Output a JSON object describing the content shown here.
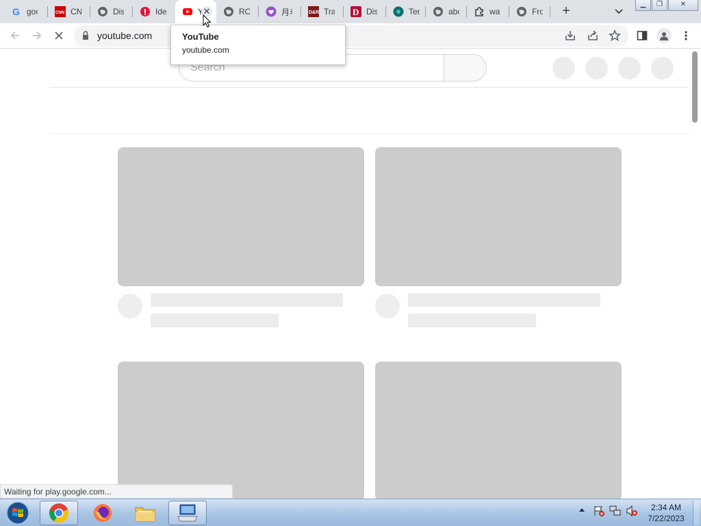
{
  "browser": {
    "tabs": [
      {
        "title": "goo",
        "icon": "google-icon"
      },
      {
        "title": "CNI",
        "icon": "cnn-icon"
      },
      {
        "title": "Dish",
        "icon": "globe-icon"
      },
      {
        "title": "Ider",
        "icon": "red-alert-icon"
      },
      {
        "title": "Y",
        "icon": "youtube-icon",
        "active": true
      },
      {
        "title": "RC (",
        "icon": "globe-icon"
      },
      {
        "title": "月老",
        "icon": "heart-icon"
      },
      {
        "title": "Trav",
        "icon": "dr-icon"
      },
      {
        "title": "Disr",
        "icon": "disney-icon"
      },
      {
        "title": "Tem",
        "icon": "teal-circle-icon"
      },
      {
        "title": "abc",
        "icon": "globe-icon"
      },
      {
        "title": "wat",
        "icon": "puzzle-icon"
      },
      {
        "title": "Fron",
        "icon": "globe-icon"
      }
    ],
    "new_tab_label": "+",
    "url": "youtube.com",
    "tooltip": {
      "title": "YouTube",
      "url": "youtube.com"
    },
    "status_text": "Waiting for play.google.com..."
  },
  "page": {
    "search_placeholder": "Search"
  },
  "taskbar": {
    "time": "2:34 AM",
    "date": "7/22/2023"
  },
  "colors": {
    "tabstrip": "#dee1e6",
    "skeleton": "#cccccc",
    "taskbar": "#a8c4e3"
  }
}
